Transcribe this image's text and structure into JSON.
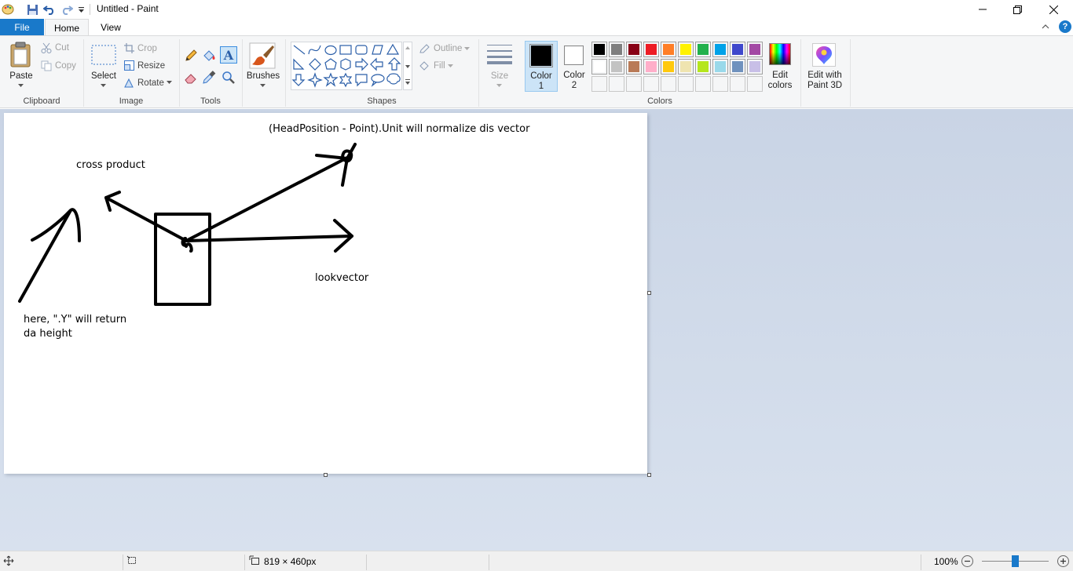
{
  "window": {
    "title": "Untitled - Paint",
    "minimize_icon": "minimize-icon",
    "maximize_icon": "restore-icon",
    "close_icon": "close-icon"
  },
  "quick_access": [
    "paint-app-icon",
    "save-icon",
    "undo-icon",
    "redo-icon",
    "customize-qat-icon"
  ],
  "tabs": {
    "file": "File",
    "home": "Home",
    "view": "View"
  },
  "ribbon": {
    "clipboard": {
      "label": "Clipboard",
      "paste": "Paste",
      "cut": "Cut",
      "copy": "Copy"
    },
    "image": {
      "label": "Image",
      "select": "Select",
      "crop": "Crop",
      "resize": "Resize",
      "rotate": "Rotate"
    },
    "tools": {
      "label": "Tools"
    },
    "brushes": {
      "label": "Brushes"
    },
    "shapes": {
      "label": "Shapes",
      "outline": "Outline",
      "fill": "Fill"
    },
    "size": {
      "label": "Size"
    },
    "colors": {
      "label": "Colors",
      "color1": "Color\n1",
      "color1_a": "Color",
      "color1_b": "1",
      "color2_a": "Color",
      "color2_b": "2",
      "edit_a": "Edit",
      "edit_b": "colors",
      "paint3d_a": "Edit with",
      "paint3d_b": "Paint 3D",
      "color1_value": "#000000",
      "color2_value": "#ffffff",
      "palette_row1": [
        "#000000",
        "#7f7f7f",
        "#880015",
        "#ed1c24",
        "#ff7f27",
        "#fff200",
        "#22b14c",
        "#00a2e8",
        "#3f48cc",
        "#a349a4"
      ],
      "palette_row2": [
        "#ffffff",
        "#c3c3c3",
        "#b97a57",
        "#ffaec9",
        "#ffc90e",
        "#efe4b0",
        "#b5e61d",
        "#99d9ea",
        "#7092be",
        "#c8bfe7"
      ],
      "palette_row3": [
        "#ffffff",
        "#ffffff",
        "#ffffff",
        "#ffffff",
        "#ffffff",
        "#ffffff",
        "#ffffff",
        "#ffffff",
        "#ffffff",
        "#ffffff"
      ]
    }
  },
  "canvas": {
    "texts": {
      "head": "(HeadPosition - Point).Unit will normalize dis vector",
      "cross": "cross product",
      "look": "lookvector",
      "here_line1": "here, \".Y\" will return",
      "here_line2": "da height"
    }
  },
  "statusbar": {
    "canvas_size": "819 × 460px",
    "zoom": "100%"
  }
}
